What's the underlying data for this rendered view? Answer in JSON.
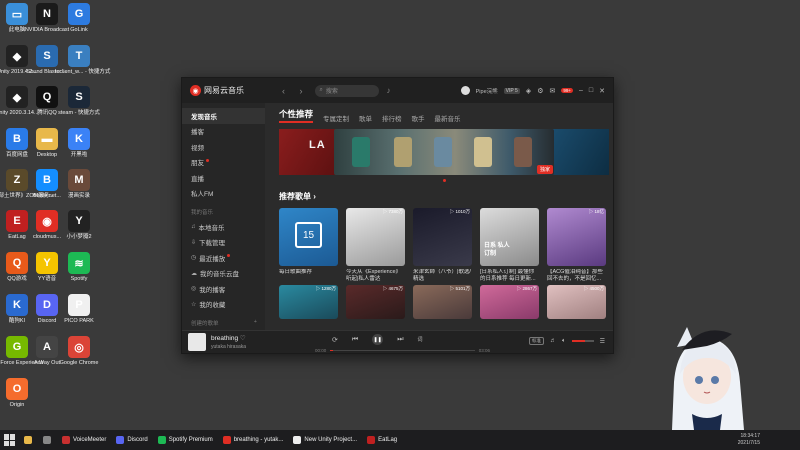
{
  "desktop": {
    "icons": [
      {
        "label": "此电脑",
        "color": "#3a8fd9",
        "glyph": "▭"
      },
      {
        "label": "NVIDIA Broadcast",
        "color": "#1a1a1a",
        "glyph": "N"
      },
      {
        "label": "GoLink",
        "color": "#2d7be0",
        "glyph": "G"
      },
      {
        "label": "Unity 2019.4.2...",
        "color": "#222",
        "glyph": "◆"
      },
      {
        "label": "Sound Blaster ...",
        "color": "#2a6bb0",
        "glyph": "S"
      },
      {
        "label": "tcclient_w... - 快捷方式",
        "color": "#3a7fc0",
        "glyph": "T"
      },
      {
        "label": "Unity 2020.3.14...",
        "color": "#222",
        "glyph": "◆"
      },
      {
        "label": "腾讯QQ",
        "color": "#111",
        "glyph": "Q"
      },
      {
        "label": "steam - 快捷方式",
        "color": "#1b2838",
        "glyph": "S"
      },
      {
        "label": "百度网盘",
        "color": "#2a7be8",
        "glyph": "B"
      },
      {
        "label": "Desktop",
        "color": "#e8b84a",
        "glyph": "▬"
      },
      {
        "label": "开黑啦",
        "color": "#3b82f6",
        "glyph": "K"
      },
      {
        "label": "《部土世界》ZOM服务...",
        "color": "#5a4a2a",
        "glyph": "Z"
      },
      {
        "label": "Battle.net...",
        "color": "#148eff",
        "glyph": "B"
      },
      {
        "label": "漫画实录",
        "color": "#6a4a3a",
        "glyph": "M"
      },
      {
        "label": "EatLag",
        "color": "#c02020",
        "glyph": "E"
      },
      {
        "label": "cloudmus...",
        "color": "#e02e24",
        "glyph": "◉"
      },
      {
        "label": "小小梦魇2",
        "color": "#222",
        "glyph": "Y"
      },
      {
        "label": "QQ游戏",
        "color": "#e85a1a",
        "glyph": "Q"
      },
      {
        "label": "YY语音",
        "color": "#f5c400",
        "glyph": "Y"
      },
      {
        "label": "Spotify",
        "color": "#1db954",
        "glyph": "≋"
      },
      {
        "label": "酷狗KI",
        "color": "#2a6ad0",
        "glyph": "K"
      },
      {
        "label": "Discord",
        "color": "#5865f2",
        "glyph": "D"
      },
      {
        "label": "PICO PARK",
        "color": "#f0f0f0",
        "glyph": "P"
      },
      {
        "label": "GeForce Experience",
        "color": "#76b900",
        "glyph": "G"
      },
      {
        "label": "A Way Out",
        "color": "#444",
        "glyph": "A"
      },
      {
        "label": "Google Chrome",
        "color": "#db4437",
        "glyph": "◎"
      },
      {
        "label": "Origin",
        "color": "#f56c2d",
        "glyph": "O"
      }
    ]
  },
  "app": {
    "name": "网易云音乐",
    "search_placeholder": "搜索",
    "username": "Pipe浣熊",
    "vip": "VIP 5",
    "badge": "99+",
    "sidebar": {
      "items": [
        {
          "label": "发现音乐",
          "active": true
        },
        {
          "label": "播客"
        },
        {
          "label": "视频"
        },
        {
          "label": "朋友",
          "dot": true
        },
        {
          "label": "直播"
        },
        {
          "label": "私人FM"
        }
      ],
      "my_music_header": "我的音乐",
      "my_music": [
        {
          "label": "本地音乐",
          "icon": "♫"
        },
        {
          "label": "下载管理",
          "icon": "⇩"
        },
        {
          "label": "最近播放",
          "icon": "◷",
          "dot": true
        },
        {
          "label": "我的音乐云盘",
          "icon": "☁"
        },
        {
          "label": "我的播客",
          "icon": "◎"
        },
        {
          "label": "我的收藏",
          "icon": "☆"
        }
      ],
      "created_header": "创建的歌单",
      "created": [
        {
          "label": "我喜欢的音乐",
          "icon": "♡"
        }
      ]
    },
    "tabs": [
      "个性推荐",
      "专属定制",
      "歌单",
      "排行榜",
      "歌手",
      "最新音乐"
    ],
    "banner": {
      "left_text": "LA",
      "tag": "独家"
    },
    "section_title": "推荐歌单 ›",
    "playlists_row1": [
      {
        "title": "每日歌曲推荐",
        "plays": "",
        "bg": "linear-gradient(160deg,#2f86c8,#1c5a94)",
        "calendar": "15"
      },
      {
        "title": "今天从《Experience》听起|私人雷达",
        "plays": "▷ 7380万",
        "bg": "linear-gradient(160deg,#e8e8e8,#9a9a9a)"
      },
      {
        "title": "米津玄師（八爷）|歌选/精选",
        "plays": "▷ 1010万",
        "bg": "linear-gradient(160deg,#1a1a2a,#3a3a4a)"
      },
      {
        "title": "[日系私人订制] 最懂你的日系推荐 每日更新...",
        "plays": "",
        "bg": "linear-gradient(160deg,#dcdcdc,#8a8a8a)",
        "overlay": "日系 私人订制"
      },
      {
        "title": "【ACG催泪纯音】那些回不去的，不是回忆...",
        "plays": "▷ 18亿",
        "bg": "linear-gradient(160deg,#b08ad0,#5a3a80)"
      }
    ],
    "playlists_row2": [
      {
        "plays": "▷ 1280万",
        "bg": "linear-gradient(160deg,#2a8aa0,#1a4a5a)"
      },
      {
        "plays": "▷ 4675万",
        "bg": "linear-gradient(160deg,#5a2a2a,#2a1a1a)"
      },
      {
        "plays": "▷ 5101万",
        "bg": "linear-gradient(160deg,#8a6a5a,#4a3a3a)"
      },
      {
        "plays": "▷ 2867万",
        "bg": "linear-gradient(160deg,#d06a9a,#8a3a6a)"
      },
      {
        "plays": "▷ 4500万",
        "bg": "linear-gradient(160deg,#e0c0c0,#a08080)"
      }
    ],
    "player": {
      "title": "breathing",
      "artist": "yutaka hirasaka",
      "time_current": "00:00",
      "time_total": "03:06",
      "progress": 0.02,
      "volume": 0.6,
      "quality": "标准",
      "lyric_btn": "词"
    }
  },
  "taskbar": {
    "items": [
      {
        "label": "VoiceMeeter",
        "color": "#c83030"
      },
      {
        "label": "Discord",
        "color": "#5865f2"
      },
      {
        "label": "Spotify Premium",
        "color": "#1db954"
      },
      {
        "label": "breathing - yutak...",
        "color": "#e02e24"
      },
      {
        "label": "New Unity Project...",
        "color": "#eeeeee"
      },
      {
        "label": "EatLag",
        "color": "#c02020"
      }
    ],
    "time": "18:34:17",
    "date": "2021/7/15"
  },
  "colors": {
    "accent": "#e02e24",
    "window_bg": "#2b2b2b"
  }
}
